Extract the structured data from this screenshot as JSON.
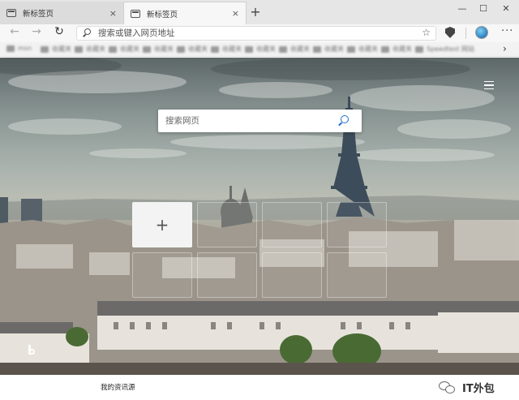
{
  "tabs": [
    {
      "label": "新标签页",
      "close_glyph": "×",
      "active": false
    },
    {
      "label": "新标签页",
      "close_glyph": "×",
      "active": true
    }
  ],
  "new_tab_glyph": "+",
  "window_controls": {
    "minimize": "—",
    "maximize": "☐",
    "close": "✕"
  },
  "toolbar": {
    "back_glyph": "←",
    "forward_glyph": "→",
    "refresh_glyph": "↻",
    "address_placeholder": "搜索或键入网页地址",
    "favorite_glyph": "☆",
    "more_glyph": "···"
  },
  "favorites_bar": {
    "items": [
      "msn",
      "收藏夹",
      "收藏夹",
      "收藏夹",
      "收藏夹",
      "收藏夹",
      "收藏夹",
      "收藏夹",
      "收藏夹",
      "收藏夹",
      "收藏夹",
      "收藏夹",
      "Speedtest 网站"
    ],
    "overflow_glyph": "›"
  },
  "page": {
    "search_placeholder": "搜索网页",
    "add_tile_glyph": "+"
  },
  "feed": {
    "label": "我的资讯源"
  },
  "watermark": {
    "text": "IT外包"
  },
  "icons": [
    "tab-page-icon",
    "back-icon",
    "forward-icon",
    "refresh-icon",
    "search-icon",
    "star-icon",
    "shield-icon",
    "profile-avatar",
    "menu-icon",
    "bing-logo",
    "wechat-icon"
  ],
  "colors": {
    "search_accent": "#1e6ec8",
    "tab_strip": "#e6e6e6",
    "toolbar": "#f7f7f7"
  }
}
